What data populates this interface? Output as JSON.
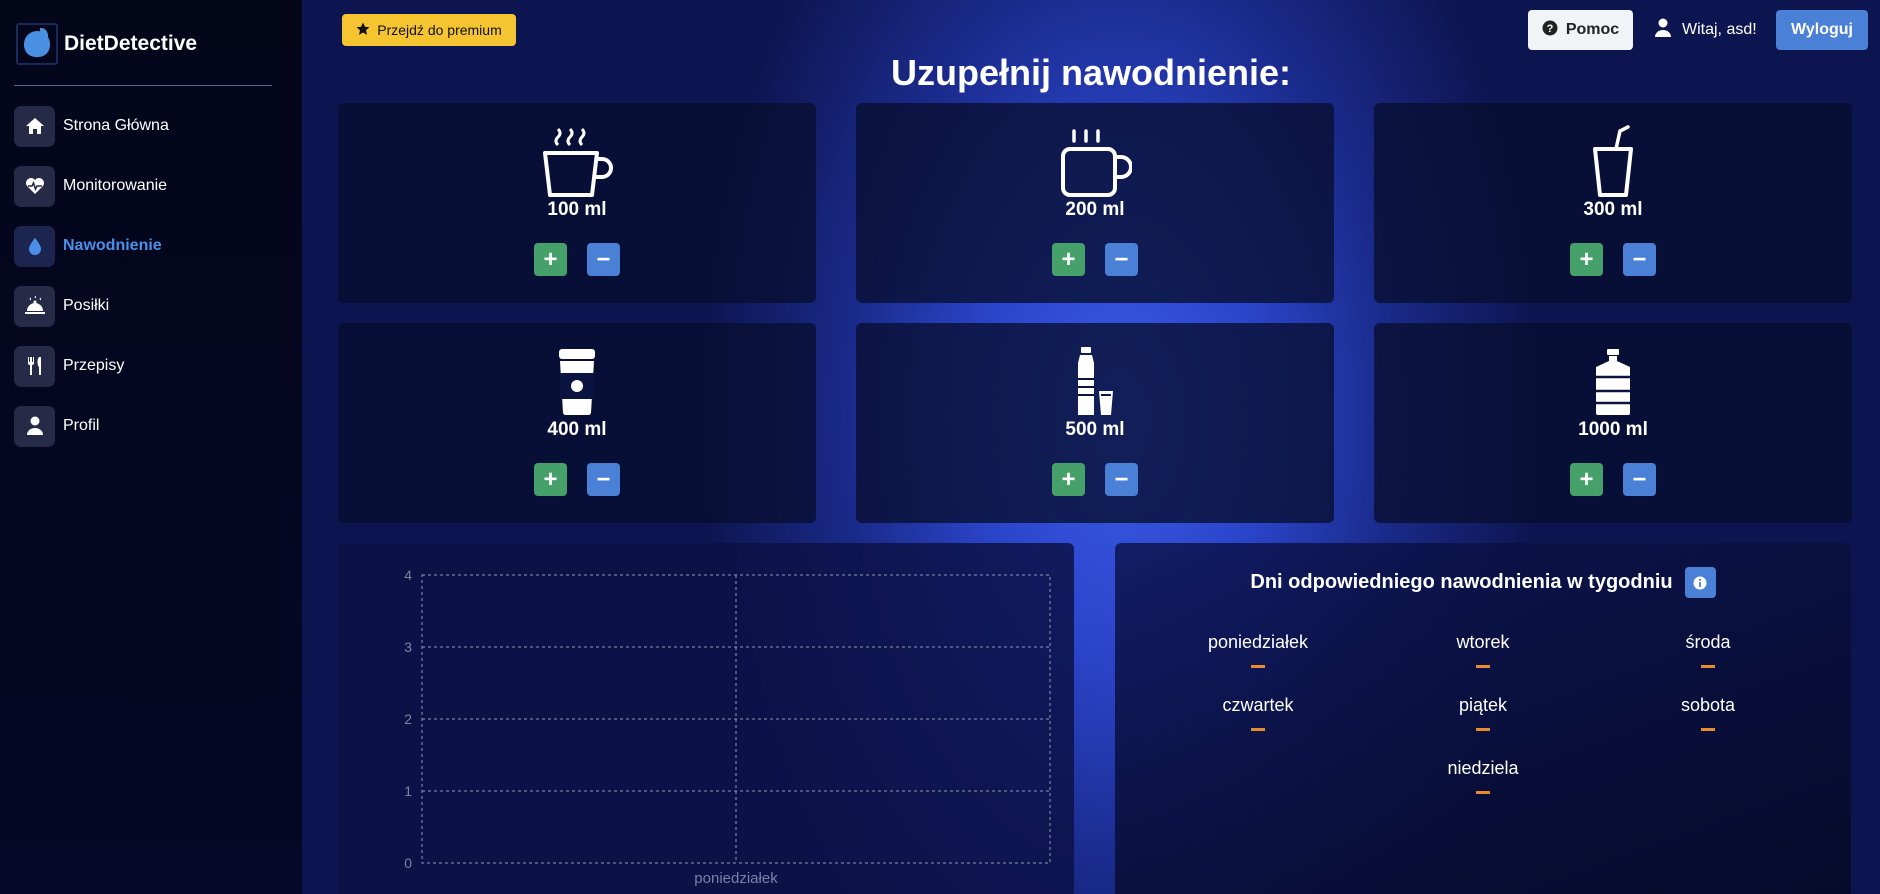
{
  "app": {
    "name": "DietDetective"
  },
  "sidebar": {
    "items": [
      {
        "label": "Strona Główna",
        "icon": "home-icon"
      },
      {
        "label": "Monitorowanie",
        "icon": "heart-pulse-icon"
      },
      {
        "label": "Nawodnienie",
        "icon": "water-drop-icon",
        "active": true
      },
      {
        "label": "Posiłki",
        "icon": "cloche-icon"
      },
      {
        "label": "Przepisy",
        "icon": "utensils-icon"
      },
      {
        "label": "Profil",
        "icon": "user-icon"
      }
    ]
  },
  "topbar": {
    "premium_label": "Przejdź do premium",
    "help_label": "Pomoc",
    "greeting": "Witaj, asd!",
    "logout_label": "Wyloguj"
  },
  "page": {
    "title": "Uzupełnij nawodnienie:"
  },
  "drinks": [
    {
      "amount": "100 ml",
      "icon": "hot-cup-icon"
    },
    {
      "amount": "200 ml",
      "icon": "mug-icon"
    },
    {
      "amount": "300 ml",
      "icon": "glass-straw-icon"
    },
    {
      "amount": "400 ml",
      "icon": "coffee-to-go-icon"
    },
    {
      "amount": "500 ml",
      "icon": "bottle-glass-icon"
    },
    {
      "amount": "1000 ml",
      "icon": "water-jug-icon"
    }
  ],
  "buttons": {
    "plus": "+",
    "minus": "−"
  },
  "week": {
    "title": "Dni odpowiedniego nawodnienia w tygodniu",
    "days": [
      {
        "name": "poniedziałek",
        "value": "—"
      },
      {
        "name": "wtorek",
        "value": "—"
      },
      {
        "name": "środa",
        "value": "—"
      },
      {
        "name": "czwartek",
        "value": "—"
      },
      {
        "name": "piątek",
        "value": "—"
      },
      {
        "name": "sobota",
        "value": "—"
      },
      {
        "name": "niedziela",
        "value": "—"
      }
    ]
  },
  "colors": {
    "accent": "#4a80d6",
    "plus": "#45a06a",
    "premium": "#f4c530",
    "dash": "#e88a2e"
  },
  "chart_data": {
    "type": "line",
    "categories": [
      "poniedziałek"
    ],
    "series": [
      {
        "values": []
      }
    ],
    "ylim": [
      0,
      4
    ],
    "yticks": [
      0,
      1,
      2,
      3,
      4
    ],
    "grid": true
  }
}
